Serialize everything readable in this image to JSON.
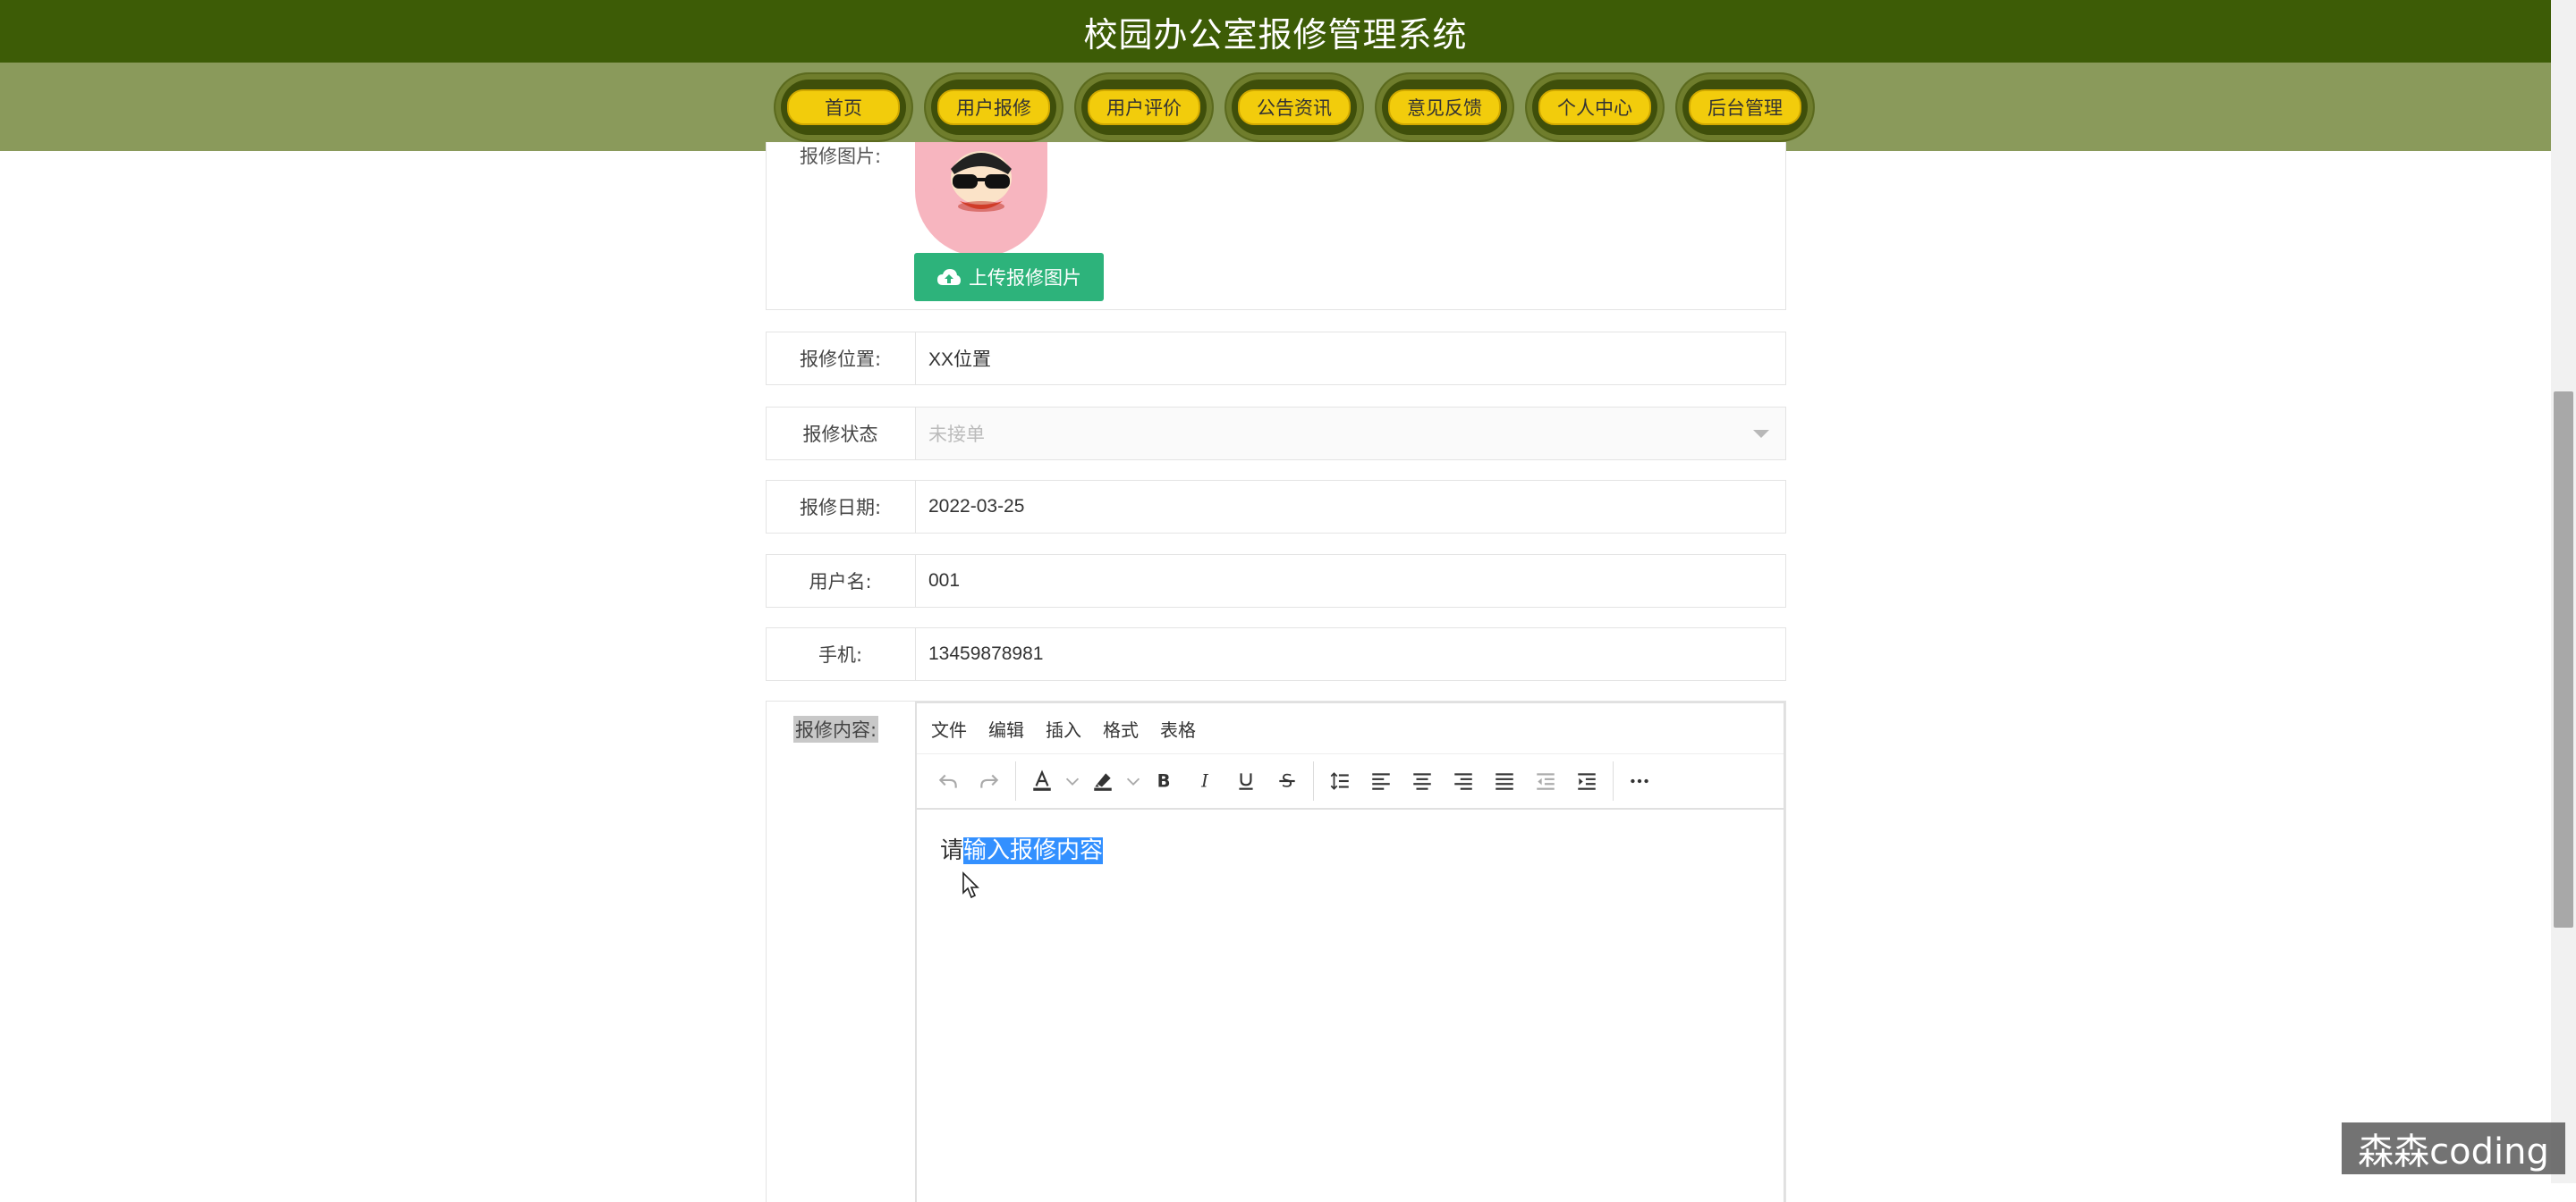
{
  "header": {
    "title": "校园办公室报修管理系统"
  },
  "nav": {
    "items": [
      {
        "label": "首页"
      },
      {
        "label": "用户报修"
      },
      {
        "label": "用户评价"
      },
      {
        "label": "公告资讯"
      },
      {
        "label": "意见反馈"
      },
      {
        "label": "个人中心"
      },
      {
        "label": "后台管理"
      }
    ]
  },
  "form": {
    "image": {
      "label": "报修图片:",
      "upload_label": "上传报修图片"
    },
    "location": {
      "label": "报修位置:",
      "value": "XX位置"
    },
    "status": {
      "label": "报修状态",
      "value": "未接单"
    },
    "date": {
      "label": "报修日期:",
      "value": "2022-03-25"
    },
    "username": {
      "label": "用户名:",
      "value": "001"
    },
    "phone": {
      "label": "手机:",
      "value": "13459878981"
    },
    "content": {
      "label": "报修内容:",
      "menu": [
        "文件",
        "编辑",
        "插入",
        "格式",
        "表格"
      ],
      "text_plain": "请",
      "text_selected": "输入报修内容"
    }
  },
  "watermark": "森森coding",
  "colors": {
    "title_bg": "#3d5c06",
    "nav_bg": "#8a9a5b",
    "nav_pill": "#f2cc0c",
    "upload_button": "#2db37b",
    "selection": "#3390ff"
  }
}
